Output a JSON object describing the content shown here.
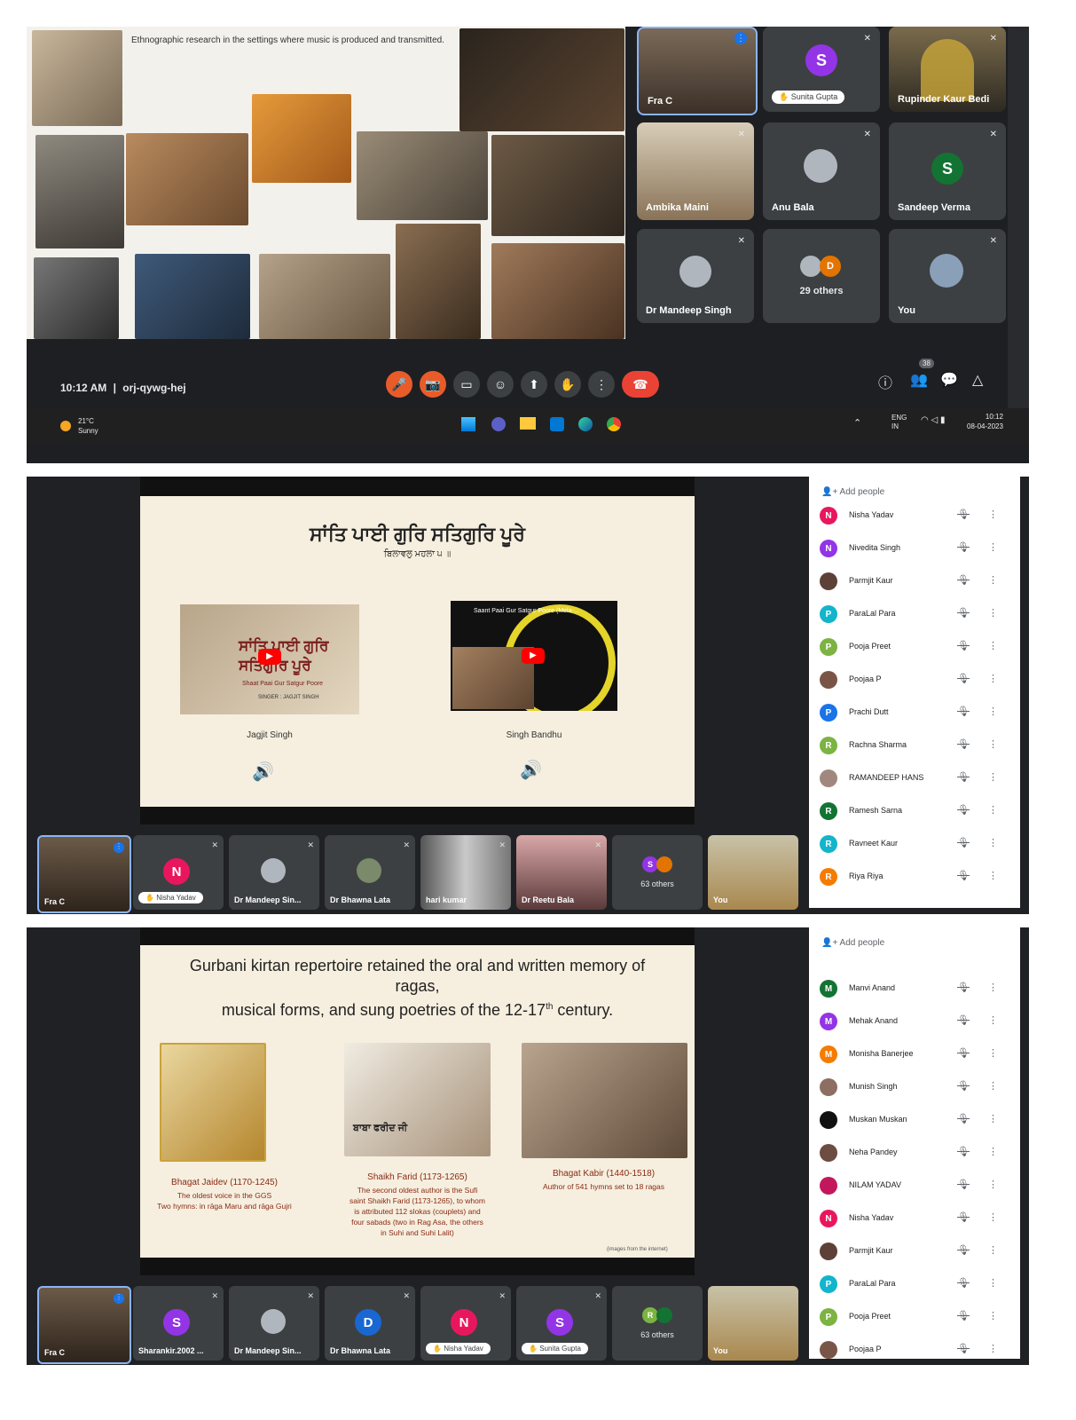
{
  "panel1": {
    "slide_text": "Ethnographic research in the settings where music is produced and transmitted.",
    "tiles": [
      {
        "name": "Fra C",
        "kind": "photo",
        "color": "#6b5a48"
      },
      {
        "name": "Sunita Gupta",
        "initial": "S",
        "color": "#9334e6",
        "kind": "pill"
      },
      {
        "name": "Rupinder Kaur Bedi",
        "kind": "photo",
        "color": "#8a6a2a"
      },
      {
        "name": "Ambika Maini",
        "kind": "photo",
        "color": "#b8a07a"
      },
      {
        "name": "Anu Bala",
        "kind": "photo",
        "color": "#3c4043"
      },
      {
        "name": "Sandeep Verma",
        "initial": "S",
        "color": "#137333",
        "kind": "avatar"
      },
      {
        "name": "Dr Mandeep Singh",
        "kind": "photo",
        "color": "#3c4043"
      },
      {
        "name": "29 others",
        "kind": "others",
        "initial": "D",
        "color": "#e37400"
      },
      {
        "name": "You",
        "kind": "photo",
        "color": "#3c4043"
      }
    ],
    "time": "10:12 AM",
    "separator": "|",
    "meeting_code": "orj-qywg-hej",
    "participant_count": "38",
    "weather_temp": "21°C",
    "weather_desc": "Sunny",
    "lang_top": "ENG",
    "lang_bottom": "IN",
    "clock_time": "10:12",
    "clock_date": "08-04-2023"
  },
  "panel2": {
    "slide_title": "ਸਾਂਤਿ ਪਾਈ ਗੁਰਿ ਸਤਿਗੁਰਿ ਪੂਰੇ",
    "slide_subtitle": "ਬਿਲਾਵਲੁ ਮਹਲਾ ੫ ॥",
    "video1_title_text": "ਸਾਂਤਿ ਪਾਈ ਗੁਰਿ ਸਤਿਗੁਰਿ ਪੂਰੇ",
    "video1_sub": "Shaat Paai Gur Satgur Poore",
    "video1_singer": "SINGER : JAGJIT SINGH",
    "video1_label": "Jagjit Singh",
    "video2_title_text": "Saant Paai Gur Satgur Poore (Mela-...",
    "video2_label": "Singh Bandhu",
    "strip": [
      {
        "name": "Fra C"
      },
      {
        "name": "Nisha Yadav",
        "initial": "N",
        "color": "#e8175d",
        "pill": true
      },
      {
        "name": "Dr Mandeep Sin..."
      },
      {
        "name": "Dr Bhawna Lata"
      },
      {
        "name": "hari kumar"
      },
      {
        "name": "Dr Reetu Bala"
      },
      {
        "name": "63 others",
        "initial": "S",
        "color": "#9334e6"
      },
      {
        "name": "You"
      }
    ],
    "add_people": "Add people",
    "people": [
      {
        "name": "Nisha Yadav",
        "initial": "N",
        "color": "#e8175d"
      },
      {
        "name": "Nivedita Singh",
        "initial": "N",
        "color": "#9334e6"
      },
      {
        "name": "Parmjit Kaur",
        "initial": "",
        "color": "#5d4037"
      },
      {
        "name": "ParaLal Para",
        "initial": "P",
        "color": "#12b5cb"
      },
      {
        "name": "Pooja Preet",
        "initial": "P",
        "color": "#7cb342"
      },
      {
        "name": "Poojaa P",
        "initial": "",
        "color": "#795548"
      },
      {
        "name": "Prachi Dutt",
        "initial": "P",
        "color": "#1a73e8"
      },
      {
        "name": "Rachna Sharma",
        "initial": "R",
        "color": "#7cb342"
      },
      {
        "name": "RAMANDEEP HANS",
        "initial": "",
        "color": "#a1887f"
      },
      {
        "name": "Ramesh Sarna",
        "initial": "R",
        "color": "#137333"
      },
      {
        "name": "Ravneet Kaur",
        "initial": "R",
        "color": "#12b5cb"
      },
      {
        "name": "Riya Riya",
        "initial": "R",
        "color": "#f57c00"
      }
    ]
  },
  "panel3": {
    "slide_title_line1": "Gurbani kirtan repertoire retained the oral and written memory of",
    "slide_title_line2": "ragas,",
    "slide_title_line3a": "musical forms, and sung poetries of the 12-17",
    "slide_title_sup": "th",
    "slide_title_line3b": " century.",
    "img1_caption": "Bhagat Jaidev (1170-1245)",
    "img1_desc1": "The oldest voice in the GGS",
    "img1_desc2": "Two hymns: in rāga Maru and rāga Gujri",
    "img2_overlay": "ਬਾਬਾ ਫਰੀਦ ਜੀ",
    "img2_caption": "Shaikh Farid (1173-1265)",
    "img2_desc": [
      "The second oldest author is the Sufi",
      "saint Shaikh Farid (1173-1265), to whom",
      "is attributed 112 slokas (couplets) and",
      "four sabads (two in Rag Asa, the others",
      "in Suhi and Suhi Lalit)"
    ],
    "img3_caption": "Bhagat Kabir (1440-1518)",
    "img3_desc": "Author of 541 hymns set to 18 ragas",
    "footnote": "(images from the internet)",
    "strip": [
      {
        "name": "Fra C"
      },
      {
        "name": "Sharankir.2002 ...",
        "initial": "S",
        "color": "#9334e6"
      },
      {
        "name": "Dr Mandeep Sin..."
      },
      {
        "name": "Dr Bhawna Lata",
        "initial": "D",
        "color": "#1967d2"
      },
      {
        "name": "Nisha Yadav",
        "initial": "N",
        "color": "#e8175d",
        "pill": true
      },
      {
        "name": "Sunita Gupta",
        "initial": "S",
        "color": "#9334e6",
        "pill": true
      },
      {
        "name": "63 others",
        "initial": "R",
        "color": "#7cb342"
      },
      {
        "name": "You"
      }
    ],
    "add_people": "Add people",
    "people": [
      {
        "name": "Manvi Anand",
        "initial": "M",
        "color": "#137333"
      },
      {
        "name": "Mehak Anand",
        "initial": "M",
        "color": "#9334e6"
      },
      {
        "name": "Monisha Banerjee",
        "initial": "M",
        "color": "#f57c00"
      },
      {
        "name": "Munish Singh",
        "initial": "",
        "color": "#8d6e63"
      },
      {
        "name": "Muskan Muskan",
        "initial": "",
        "color": "#111111"
      },
      {
        "name": "Neha Pandey",
        "initial": "",
        "color": "#6d4c41"
      },
      {
        "name": "NILAM YADAV",
        "initial": "",
        "color": "#c2185b"
      },
      {
        "name": "Nisha Yadav",
        "initial": "N",
        "color": "#e8175d"
      },
      {
        "name": "Parmjit Kaur",
        "initial": "",
        "color": "#5d4037"
      },
      {
        "name": "ParaLal Para",
        "initial": "P",
        "color": "#12b5cb"
      },
      {
        "name": "Pooja Preet",
        "initial": "P",
        "color": "#7cb342"
      },
      {
        "name": "Poojaa P",
        "initial": "",
        "color": "#795548"
      }
    ]
  }
}
